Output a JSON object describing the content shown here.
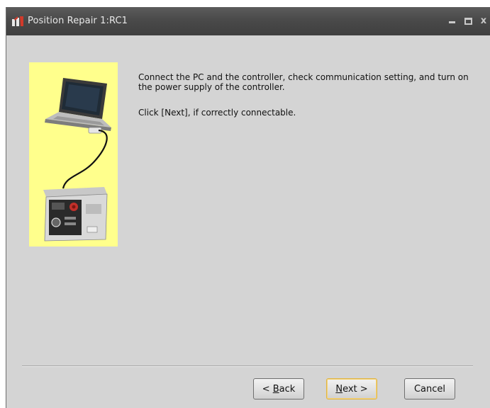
{
  "window": {
    "title": "Position Repair 1:RC1",
    "min_icon": "minimize-icon",
    "max_icon": "maximize-icon",
    "close_glyph": "x"
  },
  "content": {
    "illustration": "laptop-connected-to-controller",
    "message_line1": "Connect the PC and the controller, check communication setting, and turn on the power supply of the controller.",
    "message_line2": "Click [Next], if correctly connectable."
  },
  "buttons": {
    "back_prefix": "< ",
    "back_mnemonic": "B",
    "back_rest": "ack",
    "next_mnemonic": "N",
    "next_rest": "ext >",
    "cancel": "Cancel"
  },
  "colors": {
    "title_bar": "#4a4a4a",
    "window_bg": "#d4d4d4",
    "illustration_bg": "#ffff8c",
    "default_button_border": "#e0b542"
  }
}
